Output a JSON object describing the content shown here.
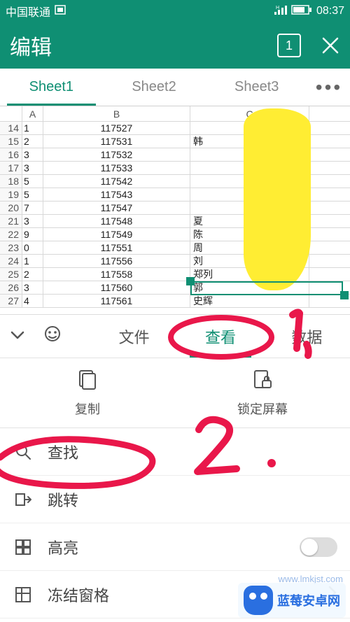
{
  "status": {
    "carrier": "中国联通",
    "time": "08:37"
  },
  "header": {
    "title": "编辑",
    "page_count": "1"
  },
  "sheet_tabs": {
    "t0": "Sheet1",
    "t1": "Sheet2",
    "t2": "Sheet3",
    "more": "•••"
  },
  "columns": {
    "A": "A",
    "B": "B",
    "C": "C"
  },
  "rows": [
    {
      "n": "14",
      "a": "1",
      "b": "117527",
      "c": ""
    },
    {
      "n": "15",
      "a": "2",
      "b": "117531",
      "c": "韩"
    },
    {
      "n": "16",
      "a": "3",
      "b": "117532",
      "c": ""
    },
    {
      "n": "17",
      "a": "3",
      "b": "117533",
      "c": ""
    },
    {
      "n": "18",
      "a": "5",
      "b": "117542",
      "c": ""
    },
    {
      "n": "19",
      "a": "5",
      "b": "117543",
      "c": ""
    },
    {
      "n": "20",
      "a": "7",
      "b": "117547",
      "c": ""
    },
    {
      "n": "21",
      "a": "3",
      "b": "117548",
      "c": "夏"
    },
    {
      "n": "22",
      "a": "9",
      "b": "117549",
      "c": "陈"
    },
    {
      "n": "23",
      "a": "0",
      "b": "117551",
      "c": "周"
    },
    {
      "n": "24",
      "a": "1",
      "b": "117556",
      "c": "刘"
    },
    {
      "n": "25",
      "a": "2",
      "b": "117558",
      "c": "郑列"
    },
    {
      "n": "26",
      "a": "3",
      "b": "117560",
      "c": "郭"
    },
    {
      "n": "27",
      "a": "4",
      "b": "117561",
      "c": "史辉"
    }
  ],
  "panel": {
    "tabs": {
      "file": "文件",
      "view": "查看",
      "data": "数据"
    },
    "actions": {
      "copy": "复制",
      "lock": "锁定屏幕"
    },
    "menu": {
      "search": "查找",
      "jump": "跳转",
      "highlight": "高亮",
      "freeze": "冻结窗格"
    }
  },
  "annotations": {
    "one": "1",
    "two": "2",
    "dot": "."
  },
  "watermark": {
    "text": "蓝莓安卓网",
    "url": "www.lmkjst.com"
  }
}
